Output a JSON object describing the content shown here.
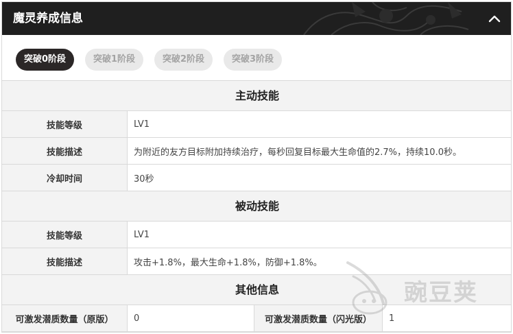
{
  "header": {
    "title": "魔灵养成信息"
  },
  "tabs": [
    {
      "label": "突破0阶段",
      "active": true
    },
    {
      "label": "突破1阶段",
      "active": false
    },
    {
      "label": "突破2阶段",
      "active": false
    },
    {
      "label": "突破3阶段",
      "active": false
    }
  ],
  "active_skill": {
    "title": "主动技能",
    "rows": [
      {
        "label": "技能等级",
        "value": "LV1"
      },
      {
        "label": "技能描述",
        "value": "为附近的友方目标附加持续治疗，每秒回复目标最大生命值的2.7%，持续10.0秒。"
      },
      {
        "label": "冷却时间",
        "value": "30秒"
      }
    ]
  },
  "passive_skill": {
    "title": "被动技能",
    "rows": [
      {
        "label": "技能等级",
        "value": "LV1"
      },
      {
        "label": "技能描述",
        "value": "攻击+1.8%，最大生命+1.8%，防御+1.8%。"
      }
    ]
  },
  "other_info": {
    "title": "其他信息",
    "original_label": "可激发潜质数量（原版）",
    "original_value": "0",
    "flash_label": "可激发潜质数量（闪光版）",
    "flash_value": "1"
  },
  "watermark": {
    "text": "豌豆荚"
  },
  "colors": {
    "header_bg": "#1f1f1f",
    "active_tab": "#2b2727",
    "inactive_tab": "#e9e9e9",
    "label_bg": "#f3f3f3"
  }
}
